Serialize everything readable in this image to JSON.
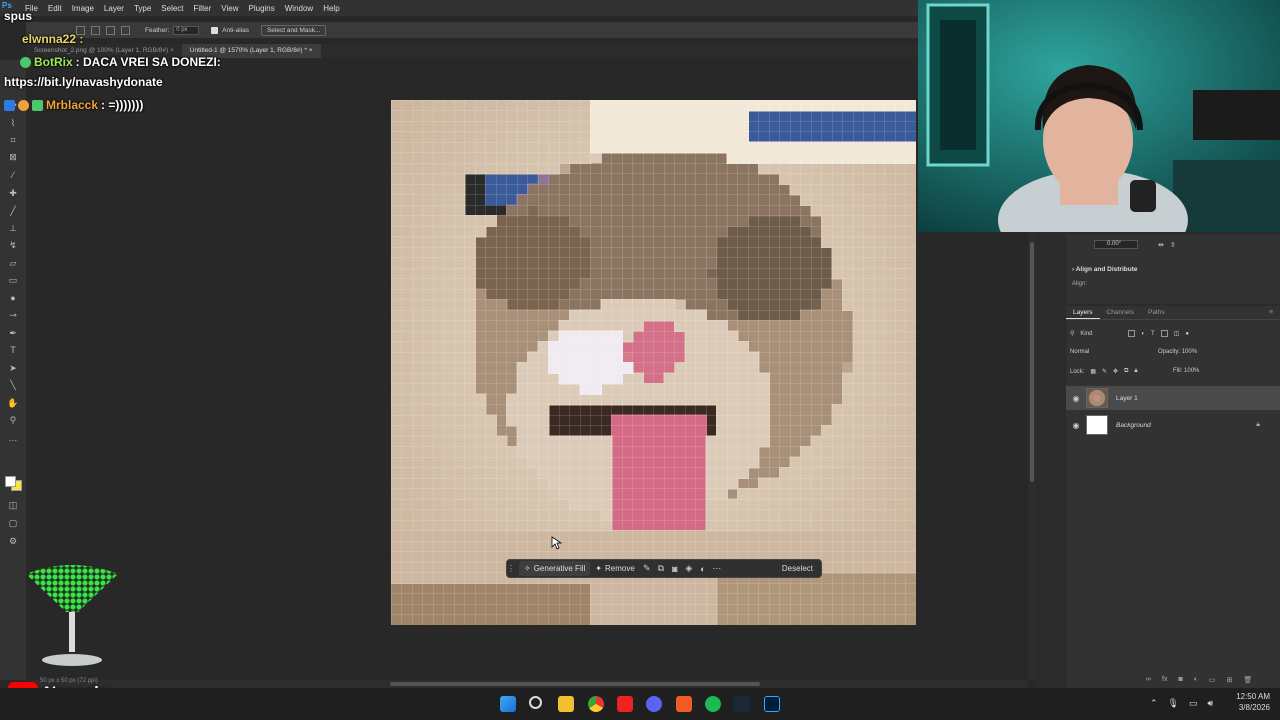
{
  "menu": {
    "items": [
      "File",
      "Edit",
      "Image",
      "Layer",
      "Type",
      "Select",
      "Filter",
      "View",
      "Plugins",
      "Window",
      "Help"
    ]
  },
  "options_bar": {
    "feather_label": "Feather:",
    "feather_value": "0 px",
    "antialias_label": "Anti-alias",
    "select_mask_label": "Select and Mask..."
  },
  "tabs": [
    {
      "label": "Screenshot_2.png @ 100% (Layer 1, RGB/8#)",
      "active": false
    },
    {
      "label": "Untitled-1 @ 1570% (Layer 1, RGB/8#) *",
      "active": true
    }
  ],
  "context_bar": {
    "generative_fill": "Generative Fill",
    "remove": "Remove",
    "deselect": "Deselect"
  },
  "status": {
    "text": "50 px x 50 px (72 ppi)"
  },
  "properties": {
    "angle": "0.00°",
    "section_title": "Align and Distribute",
    "align_label": "Align:"
  },
  "layers_panel": {
    "tabs": [
      "Layers",
      "Channels",
      "Paths"
    ],
    "filter_label": "Kind",
    "blend_mode": "Normal",
    "opacity_label": "Opacity:",
    "opacity_value": "100%",
    "lock_label": "Lock:",
    "fill_label": "Fill:",
    "fill_value": "100%",
    "layers": [
      {
        "name": "Layer 1",
        "selected": true
      },
      {
        "name": "Background",
        "selected": false
      }
    ]
  },
  "chat": {
    "line0": "spus",
    "line1_user": "elwnna22 :",
    "line2_user": "BotRix",
    "line2_text": ": DACA VREI SA DONEZI:",
    "line3_text": "https://bit.ly/navashydonate",
    "line4_user": "Mrblacck",
    "line4_text": ": =)))))))"
  },
  "channel": {
    "name": "Navashy"
  },
  "clock": {
    "time": "12:50 AM",
    "date": "3/8/2026"
  },
  "icons": {
    "taskbar": [
      "windows-start-icon",
      "search-icon",
      "file-explorer-icon",
      "chrome-icon",
      "youtube-icon",
      "discord-icon",
      "brave-icon",
      "spotify-icon",
      "steam-icon",
      "photoshop-icon"
    ]
  },
  "colors": {
    "accent": "#31a8ff",
    "foreground_swatch": "#ffffff",
    "background_swatch": "#f2e640"
  }
}
